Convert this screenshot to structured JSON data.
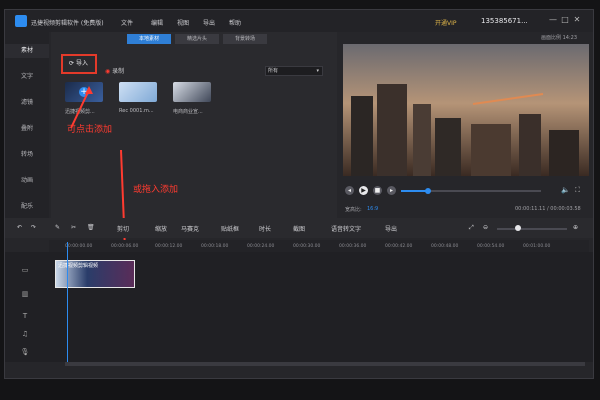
{
  "title": {
    "app": "迅捷视频剪辑软件 (免费版)",
    "menu": [
      "文件",
      "编辑",
      "视图",
      "导出",
      "帮助"
    ],
    "vip": "开通VIP",
    "user": "135385671...",
    "window_controls": [
      "—",
      "□",
      "✕"
    ]
  },
  "sidebar": {
    "items": [
      "素材",
      "文字",
      "滤镜",
      "叠附",
      "转场",
      "动画",
      "配乐"
    ]
  },
  "media": {
    "tabs": [
      "本地素材",
      "精选片头",
      "背景转场"
    ],
    "import_label": "导入",
    "record_label": "录制",
    "filter": "所有",
    "thumbs": [
      {
        "label": "迅捷视频剪..."
      },
      {
        "label": "Rec 0001.m..."
      },
      {
        "label": "电商商业宣..."
      }
    ]
  },
  "annotations": {
    "click_add": "可点击添加",
    "drag_add": "或拖入添加"
  },
  "preview": {
    "aspect": "画面比例 14:23",
    "ratio_label": "宽高比:",
    "ratio_value": "16:9",
    "time": "00:00:11.11 / 00:00:03.58"
  },
  "toolbar": {
    "items": [
      "剪切",
      "缩放",
      "马赛克",
      "贴纸框",
      "时长",
      "截图",
      "语音转文字",
      "导出"
    ]
  },
  "ruler": {
    "ticks": [
      "00:00:00.00",
      "00:00:06.00",
      "00:00:12.00",
      "00:00:18.00",
      "00:00:24.00",
      "00:00:30.00",
      "00:00:36.00",
      "00:00:42.00",
      "00:00:48.00",
      "00:00:54.00",
      "00:01:00.00"
    ]
  },
  "clip": {
    "label": "迅捷视频剪辑视频"
  },
  "colors": {
    "accent": "#2d8cf0",
    "annotation": "#ff3b30"
  }
}
